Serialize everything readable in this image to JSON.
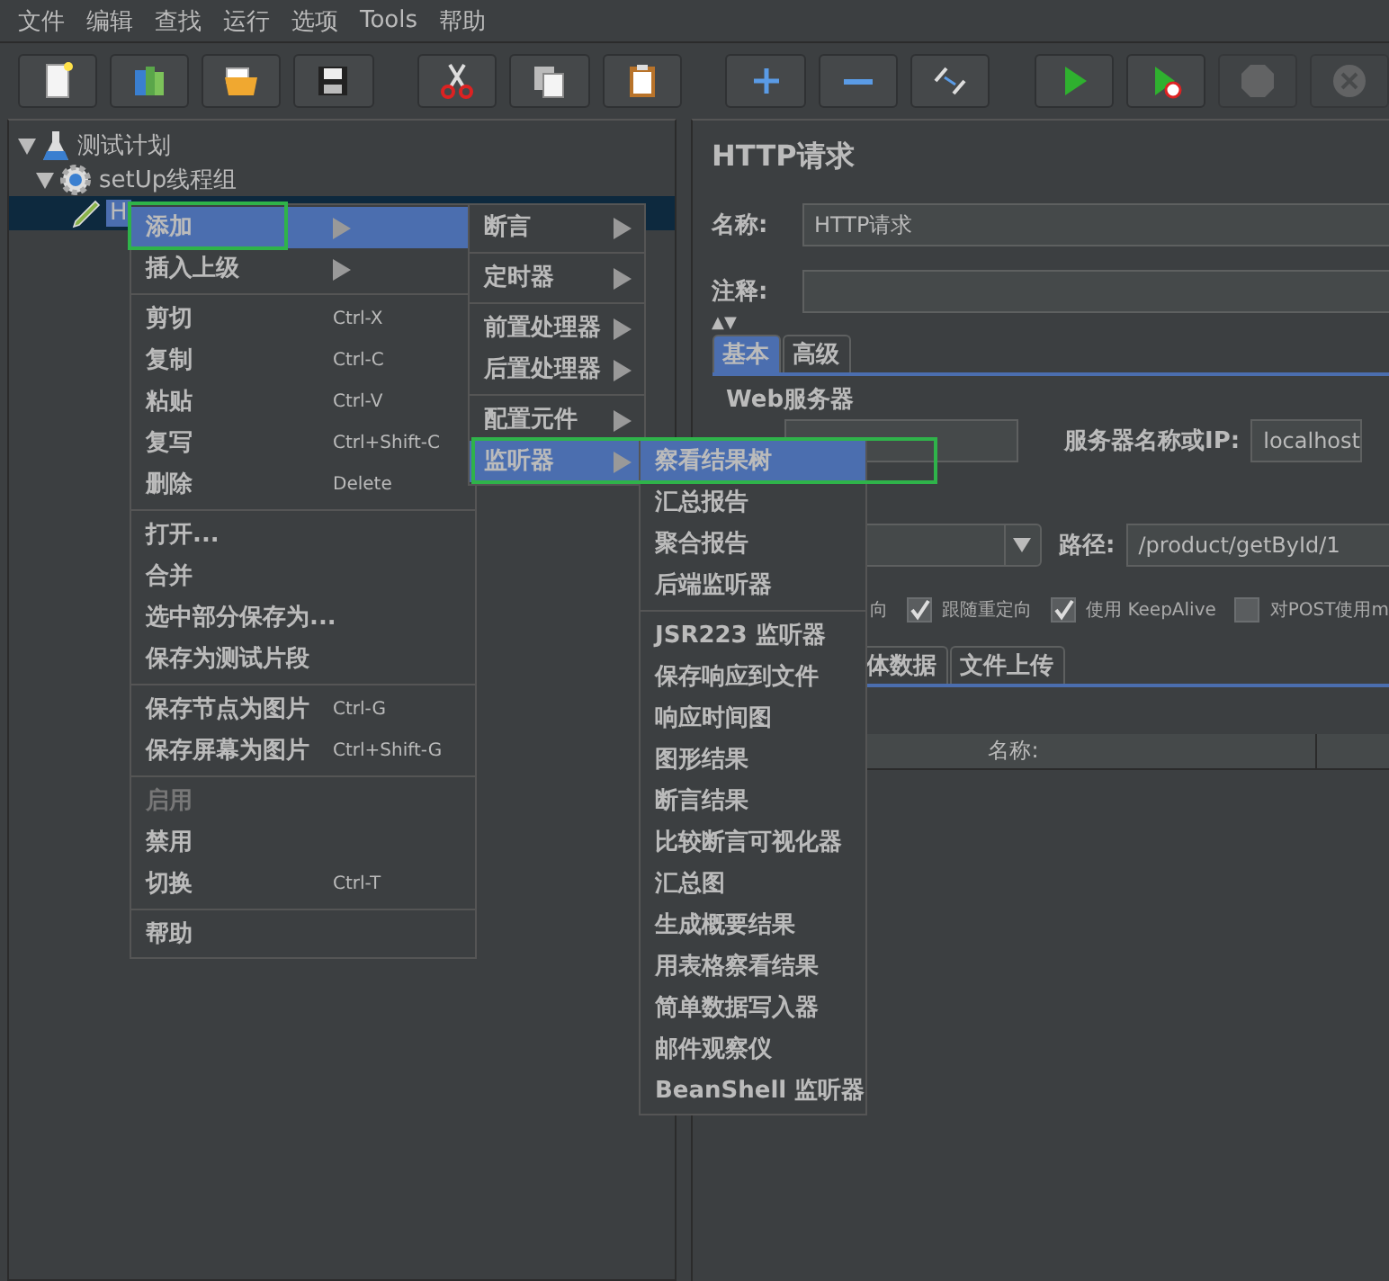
{
  "menu_bar": [
    {
      "label": "文件"
    },
    {
      "label": "编辑"
    },
    {
      "label": "查找"
    },
    {
      "label": "运行"
    },
    {
      "label": "选项"
    },
    {
      "label": "Tools"
    },
    {
      "label": "帮助"
    }
  ],
  "toolbar": [
    {
      "kind": "new",
      "disabled": false
    },
    {
      "kind": "templates",
      "disabled": false
    },
    {
      "kind": "open",
      "disabled": false
    },
    {
      "kind": "save",
      "disabled": false
    },
    {
      "kind": "gap"
    },
    {
      "kind": "cut",
      "disabled": false
    },
    {
      "kind": "copy",
      "disabled": false
    },
    {
      "kind": "paste",
      "disabled": false
    },
    {
      "kind": "gap"
    },
    {
      "kind": "expand",
      "disabled": false
    },
    {
      "kind": "collapse",
      "disabled": false
    },
    {
      "kind": "toggle",
      "disabled": false
    },
    {
      "kind": "gap"
    },
    {
      "kind": "start",
      "disabled": false
    },
    {
      "kind": "start-no-pause",
      "disabled": false
    },
    {
      "kind": "stop",
      "disabled": true
    },
    {
      "kind": "shutdown",
      "disabled": true
    }
  ],
  "tree": [
    {
      "label": "测试计划",
      "kind": "plan",
      "expanded": true,
      "selected": false,
      "children": [
        {
          "label": "setUp线程组",
          "kind": "thread-group",
          "expanded": true,
          "selected": false,
          "children": [
            {
              "label": "H",
              "kind": "sampler",
              "selected": true
            }
          ]
        }
      ]
    }
  ],
  "editor": {
    "title": "HTTP请求",
    "name_label": "名称:",
    "name_value": "HTTP请求",
    "comment_label": "注释:",
    "collapse_toggle": "▲▼",
    "tabs": [
      {
        "label": "基本",
        "selected": true
      },
      {
        "label": "高级",
        "selected": false
      }
    ],
    "web_server_legend": "Web服务器",
    "server_label": "服务器名称或IP:",
    "server_value": "localhost",
    "path_label": "路径:",
    "path_value": "/product/getById/1",
    "options": [
      {
        "kind": "text",
        "label": "向"
      },
      {
        "kind": "checkbox",
        "label": "跟随重定向",
        "checked": true
      },
      {
        "kind": "checkbox",
        "label": "使用 KeepAlive",
        "checked": true
      },
      {
        "kind": "checkbox",
        "label": "对POST使用m",
        "checked": false
      }
    ],
    "body_tabs": [
      {
        "label": "体数据",
        "selected": false
      },
      {
        "label": "文件上传",
        "selected": false
      }
    ],
    "table_columns": [
      "名称:"
    ]
  },
  "context_menu": [
    {
      "kind": "submenu",
      "label": "添加",
      "selected": true
    },
    {
      "kind": "submenu",
      "label": "插入上级",
      "selected": false
    },
    {
      "kind": "separator"
    },
    {
      "kind": "item",
      "label": "剪切",
      "shortcut": "Ctrl-X",
      "selected": false,
      "disabled": false
    },
    {
      "kind": "item",
      "label": "复制",
      "shortcut": "Ctrl-C",
      "selected": false,
      "disabled": false
    },
    {
      "kind": "item",
      "label": "粘贴",
      "shortcut": "Ctrl-V",
      "selected": false,
      "disabled": false
    },
    {
      "kind": "item",
      "label": "复写",
      "shortcut": "Ctrl+Shift-C",
      "selected": false,
      "disabled": false
    },
    {
      "kind": "item",
      "label": "删除",
      "shortcut": "Delete",
      "selected": false,
      "disabled": false
    },
    {
      "kind": "separator"
    },
    {
      "kind": "item",
      "label": "打开...",
      "selected": false,
      "disabled": false
    },
    {
      "kind": "item",
      "label": "合并",
      "selected": false,
      "disabled": false
    },
    {
      "kind": "item",
      "label": "选中部分保存为...",
      "selected": false,
      "disabled": false
    },
    {
      "kind": "item",
      "label": "保存为测试片段",
      "selected": false,
      "disabled": false
    },
    {
      "kind": "separator"
    },
    {
      "kind": "item",
      "label": "保存节点为图片",
      "shortcut": "Ctrl-G",
      "selected": false,
      "disabled": false
    },
    {
      "kind": "item",
      "label": "保存屏幕为图片",
      "shortcut": "Ctrl+Shift-G",
      "selected": false,
      "disabled": false
    },
    {
      "kind": "separator"
    },
    {
      "kind": "item",
      "label": "启用",
      "selected": false,
      "disabled": true
    },
    {
      "kind": "item",
      "label": "禁用",
      "selected": false,
      "disabled": false
    },
    {
      "kind": "item",
      "label": "切换",
      "shortcut": "Ctrl-T",
      "selected": false,
      "disabled": false
    },
    {
      "kind": "separator"
    },
    {
      "kind": "item",
      "label": "帮助",
      "selected": false,
      "disabled": false
    }
  ],
  "add_menu": [
    {
      "kind": "submenu",
      "label": "断言",
      "selected": false
    },
    {
      "kind": "separator"
    },
    {
      "kind": "submenu",
      "label": "定时器",
      "selected": false
    },
    {
      "kind": "separator"
    },
    {
      "kind": "submenu",
      "label": "前置处理器",
      "selected": false
    },
    {
      "kind": "submenu",
      "label": "后置处理器",
      "selected": false
    },
    {
      "kind": "separator"
    },
    {
      "kind": "submenu",
      "label": "配置元件",
      "selected": false
    },
    {
      "kind": "submenu",
      "label": "监听器",
      "selected": true
    }
  ],
  "listener_menu": [
    {
      "kind": "item",
      "label": "察看结果树",
      "selected": true,
      "disabled": false
    },
    {
      "kind": "item",
      "label": "汇总报告",
      "selected": false,
      "disabled": false
    },
    {
      "kind": "item",
      "label": "聚合报告",
      "selected": false,
      "disabled": false
    },
    {
      "kind": "item",
      "label": "后端监听器",
      "selected": false,
      "disabled": false
    },
    {
      "kind": "separator"
    },
    {
      "kind": "item",
      "label": "JSR223 监听器",
      "selected": false,
      "disabled": false
    },
    {
      "kind": "item",
      "label": "保存响应到文件",
      "selected": false,
      "disabled": false
    },
    {
      "kind": "item",
      "label": "响应时间图",
      "selected": false,
      "disabled": false
    },
    {
      "kind": "item",
      "label": "图形结果",
      "selected": false,
      "disabled": false
    },
    {
      "kind": "item",
      "label": "断言结果",
      "selected": false,
      "disabled": false
    },
    {
      "kind": "item",
      "label": "比较断言可视化器",
      "selected": false,
      "disabled": false
    },
    {
      "kind": "item",
      "label": "汇总图",
      "selected": false,
      "disabled": false
    },
    {
      "kind": "item",
      "label": "生成概要结果",
      "selected": false,
      "disabled": false
    },
    {
      "kind": "item",
      "label": "用表格察看结果",
      "selected": false,
      "disabled": false
    },
    {
      "kind": "item",
      "label": "简单数据写入器",
      "selected": false,
      "disabled": false
    },
    {
      "kind": "item",
      "label": "邮件观察仪",
      "selected": false,
      "disabled": false
    },
    {
      "kind": "item",
      "label": "BeanShell 监听器",
      "selected": false,
      "disabled": false
    }
  ]
}
